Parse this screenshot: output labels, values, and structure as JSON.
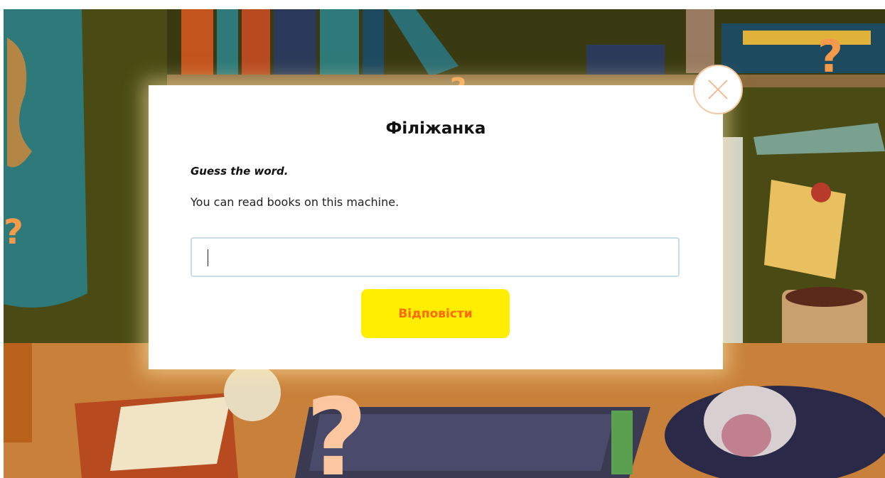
{
  "dialog": {
    "title": "Філіжанка",
    "instruction": "Guess the word.",
    "question": "You can read books on this machine.",
    "answer_value": "",
    "submit_label": "Відповісти"
  },
  "colors": {
    "submit_background": "#ffee00",
    "submit_text": "#ff6a00",
    "close_border": "#f2c9a0",
    "scene_wall": "#4a4a14",
    "scene_desk": "#c9803a"
  },
  "icons": {
    "close": "close-icon"
  }
}
